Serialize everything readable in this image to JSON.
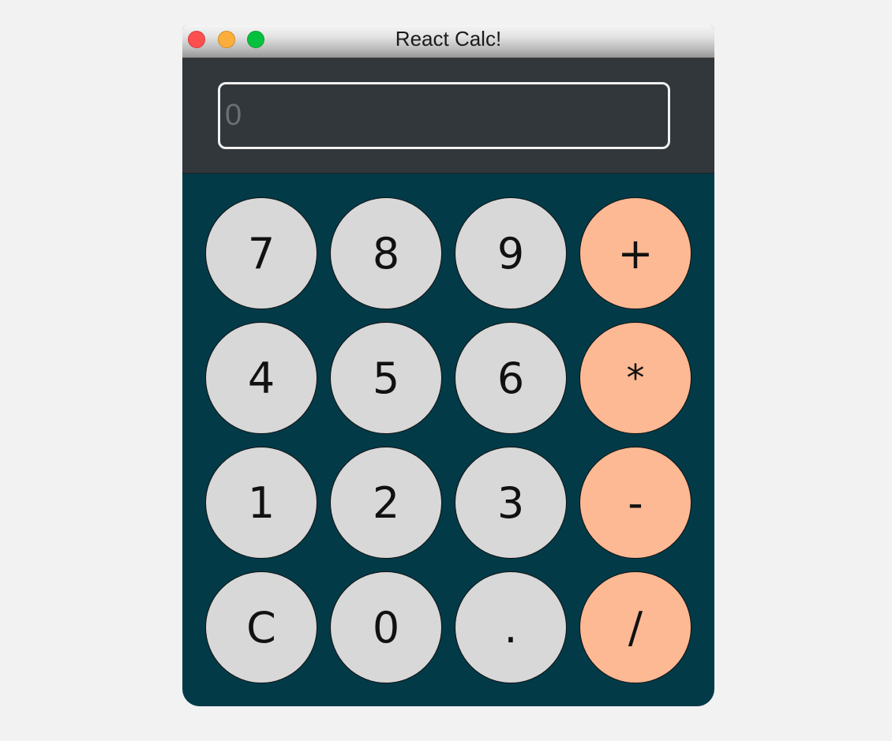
{
  "window": {
    "title": "React Calc!"
  },
  "display": {
    "value": "",
    "placeholder": "0"
  },
  "keys": {
    "k7": "7",
    "k8": "8",
    "k9": "9",
    "plus": "+",
    "k4": "4",
    "k5": "5",
    "k6": "6",
    "multiply": "*",
    "k1": "1",
    "k2": "2",
    "k3": "3",
    "minus": "-",
    "clear": "C",
    "k0": "0",
    "decimal": ".",
    "divide": "/"
  },
  "colors": {
    "page_background": "#f2f2f2",
    "keypad_background": "#023a48",
    "display_background": "#31373b",
    "digit_key": "#d8d8d8",
    "operator_key": "#fcb994",
    "close_button": "#fc4f50",
    "minimize_button": "#fcae3c",
    "maximize_button": "#06c13d"
  }
}
